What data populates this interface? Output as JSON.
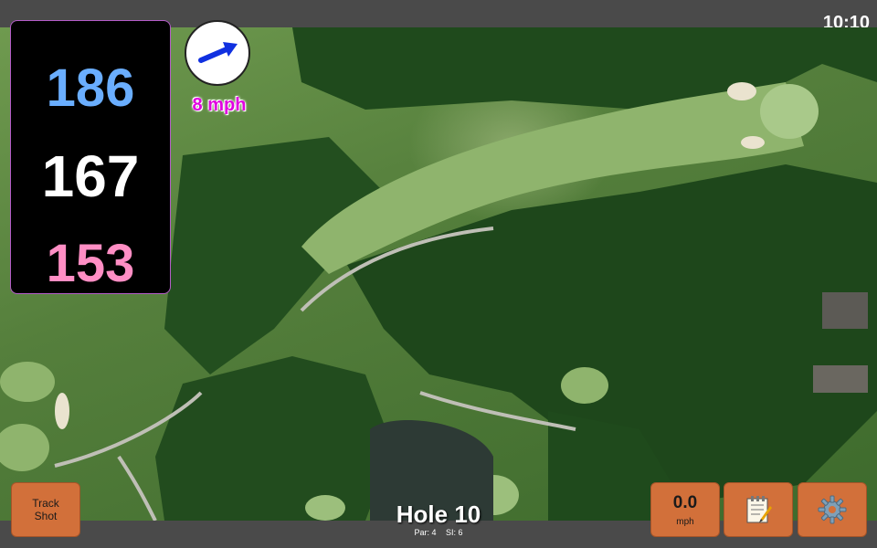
{
  "status": {
    "clock": "10:10"
  },
  "distances": {
    "back": "186",
    "center": "167",
    "front": "153"
  },
  "wind": {
    "speed": "8 mph",
    "arrow_color": "#1030e0"
  },
  "hole": {
    "title": "Hole 10",
    "par": "Par: 4",
    "si": "SI: 6"
  },
  "buttons": {
    "track_shot_line1": "Track",
    "track_shot_line2": "Shot",
    "speed_value": "0.0",
    "speed_unit": "mph",
    "notes_icon": "notepad-icon",
    "settings_icon": "gear-icon"
  },
  "colors": {
    "button_bg": "#d2703a",
    "back_distance": "#6aaeff",
    "front_distance": "#ff8ec4",
    "wind_text": "#e000e0"
  }
}
